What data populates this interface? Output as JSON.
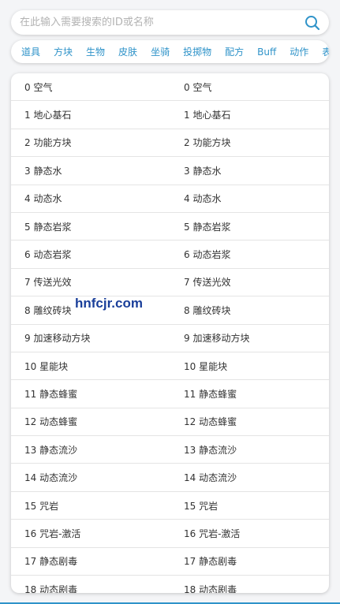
{
  "search": {
    "placeholder": "在此输入需要搜索的ID或名称"
  },
  "tabs": [
    "道具",
    "方块",
    "生物",
    "皮肤",
    "坐骑",
    "投掷物",
    "配方",
    "Buff",
    "动作",
    "表情"
  ],
  "rows": [
    {
      "left": "0 空气",
      "right": "0 空气"
    },
    {
      "left": "1 地心基石",
      "right": "1 地心基石"
    },
    {
      "left": "2 功能方块",
      "right": "2 功能方块"
    },
    {
      "left": "3 静态水",
      "right": "3 静态水"
    },
    {
      "left": "4 动态水",
      "right": "4 动态水"
    },
    {
      "left": "5 静态岩浆",
      "right": "5 静态岩浆"
    },
    {
      "left": "6 动态岩浆",
      "right": "6 动态岩浆"
    },
    {
      "left": "7 传送光效",
      "right": "7 传送光效"
    },
    {
      "left": "8 雕纹砖块",
      "right": "8 雕纹砖块"
    },
    {
      "left": "9 加速移动方块",
      "right": "9 加速移动方块"
    },
    {
      "left": "10 星能块",
      "right": "10 星能块"
    },
    {
      "left": "11 静态蜂蜜",
      "right": "11 静态蜂蜜"
    },
    {
      "left": "12 动态蜂蜜",
      "right": "12 动态蜂蜜"
    },
    {
      "left": "13 静态流沙",
      "right": "13 静态流沙"
    },
    {
      "left": "14 动态流沙",
      "right": "14 动态流沙"
    },
    {
      "left": "15 咒岩",
      "right": "15 咒岩"
    },
    {
      "left": "16 咒岩-激活",
      "right": "16 咒岩-激活"
    },
    {
      "left": "17 静态剧毒",
      "right": "17 静态剧毒"
    },
    {
      "left": "18 动态剧毒",
      "right": "18 动态剧毒"
    }
  ],
  "watermark": "hnfcjr.com",
  "colors": {
    "accent": "#2f93c9",
    "watermark": "#1a3f9a"
  }
}
